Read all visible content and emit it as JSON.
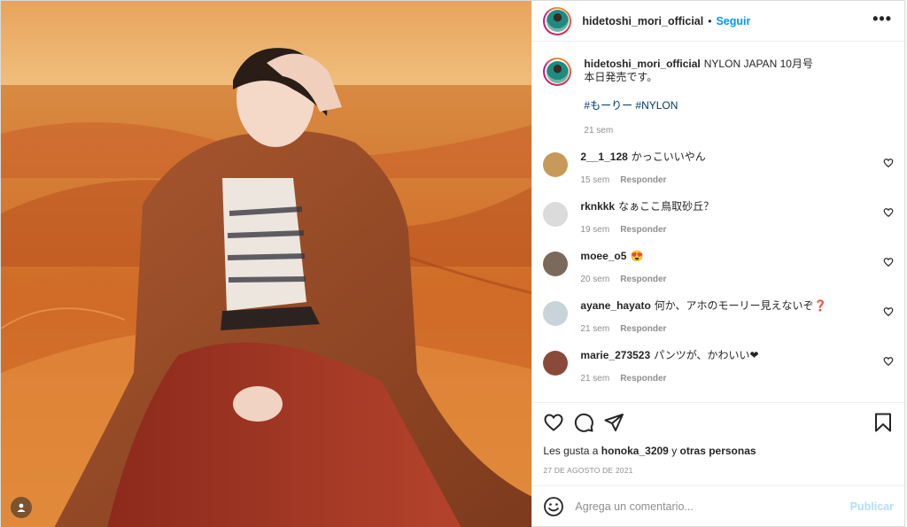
{
  "post": {
    "username": "hidetoshi_mori_official",
    "follow_label": "Seguir",
    "separator": "•",
    "more_label": "•••"
  },
  "caption": {
    "username": "hidetoshi_mori_official",
    "text_line1": "NYLON JAPAN 10月号",
    "text_line2": "本日発売です。",
    "hashtags": "#もーりー #NYLON",
    "time": "21 sem"
  },
  "reply_label": "Responder",
  "comments": [
    {
      "user": "2__1_128",
      "text": "かっこいいやん",
      "time": "15 sem",
      "avatar_color": "#c79a5a"
    },
    {
      "user": "rknkkk",
      "text": "なぁここ鳥取砂丘？",
      "time": "19 sem",
      "avatar_color": "#dbdbdb"
    },
    {
      "user": "moee_o5",
      "text": "😍",
      "time": "20 sem",
      "avatar_color": "#7b6a5c"
    },
    {
      "user": "ayane_hayato",
      "text": "何か、アホのモーリー見えないぞ❓",
      "time": "21 sem",
      "avatar_color": "#c9d3da"
    },
    {
      "user": "marie_273523",
      "text": "パンツが、かわいい❤",
      "time": "21 sem",
      "avatar_color": "#8a4a3a"
    }
  ],
  "likes": {
    "prefix": "Les gusta a",
    "user": "honoka_3209",
    "connector": "y",
    "others": "otras personas"
  },
  "date": "27 DE AGOSTO DE 2021",
  "comment_input": {
    "placeholder": "Agrega un comentario...",
    "post_label": "Publicar"
  },
  "colors": {
    "link_blue": "#0095f6",
    "hashtag": "#00376b",
    "muted": "#8e8e8e",
    "post_disabled": "#b2dffc",
    "desert_orange": "#d9782e",
    "sky": "#e9b26a"
  },
  "icons": [
    "heart-icon",
    "comment-icon",
    "share-icon",
    "bookmark-icon",
    "emoji-icon",
    "user-tag-icon",
    "more-icon"
  ]
}
